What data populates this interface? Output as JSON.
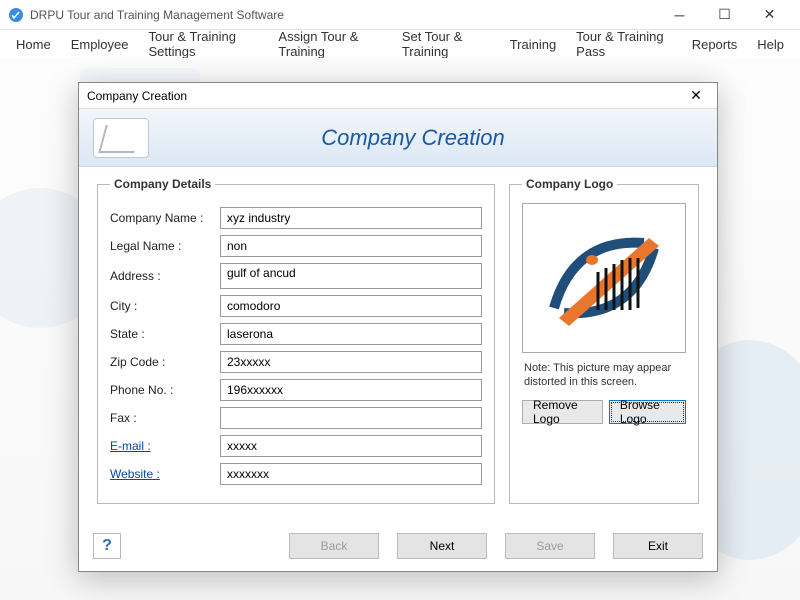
{
  "app": {
    "title": "DRPU Tour and Training Management Software"
  },
  "menu": {
    "home": "Home",
    "employee": "Employee",
    "tour_settings": "Tour & Training Settings",
    "assign": "Assign Tour & Training",
    "set": "Set Tour & Training",
    "training": "Training",
    "pass": "Tour & Training Pass",
    "reports": "Reports",
    "help": "Help"
  },
  "dialog": {
    "title": "Company Creation",
    "heading": "Company Creation",
    "details_legend": "Company Details",
    "logo_legend": "Company Logo",
    "labels": {
      "company_name": "Company Name :",
      "legal_name": "Legal Name :",
      "address": "Address :",
      "city": "City :",
      "state": "State :",
      "zip": "Zip Code :",
      "phone": "Phone No. :",
      "fax": "Fax :",
      "email": "E-mail :",
      "website": "Website :"
    },
    "values": {
      "company_name": "xyz industry",
      "legal_name": "non",
      "address": "gulf of ancud",
      "city": "comodoro",
      "state": "laserona",
      "zip": "23xxxxx",
      "phone": "196xxxxxx",
      "fax": "",
      "email": "xxxxx",
      "website": "xxxxxxx"
    },
    "logo_note": "Note: This picture may appear distorted in this screen.",
    "buttons": {
      "remove_logo": "Remove Logo",
      "browse_logo": "Browse Logo",
      "back": "Back",
      "next": "Next",
      "save": "Save",
      "exit": "Exit"
    }
  }
}
